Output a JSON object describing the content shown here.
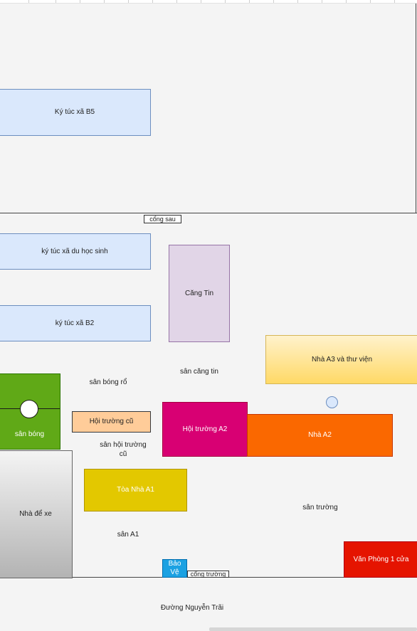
{
  "buildings": {
    "ktx_b5": "Ký túc xã B5",
    "ktx_du_hoc_sinh": "ký túc xã du học sinh",
    "ktx_b2": "ký túc xã B2",
    "cang_tin": "Căng Tin",
    "nha_a3": "Nhà A3 và thư viện",
    "hoi_truong_cu": "Hội trường cũ",
    "hoi_truong_a2": "Hội trường A2",
    "nha_a2": "Nhà A2",
    "toa_nha_a1": "Tòa Nhà A1",
    "nha_de_xe": "Nhà để xe",
    "bao_ve": "Bảo Vệ",
    "van_phong": "Văn Phòng 1 cửa"
  },
  "areas": {
    "san_bong_ro": "sân bóng rổ",
    "san_cang_tin": "sân căng tin",
    "san_bong": "sân bóng",
    "san_hoi_truong_cu": "sân hội trường cũ",
    "san_truong": "sân trường",
    "san_a1": "sân A1"
  },
  "gates": {
    "cong_sau": "cổng sau",
    "cong_truong": "cổng trường"
  },
  "road": "Đường Nguyễn Trãi",
  "colors": {
    "dorm_fill": "#dae8fc",
    "dorm_border": "#6c8ebf",
    "canteen_fill": "#e1d5e7",
    "a3_gradient": [
      "#fff2cc",
      "#ffd966"
    ],
    "old_hall_fill": "#ffcc99",
    "hall_a2_fill": "#d80073",
    "a2_fill": "#fa6800",
    "a1_fill": "#e3c800",
    "guard_fill": "#1ba1e2",
    "office_fill": "#e51400",
    "field_fill": "#60a917",
    "parking_gradient": [
      "#f4f4f4",
      "#b3b3b3"
    ]
  }
}
